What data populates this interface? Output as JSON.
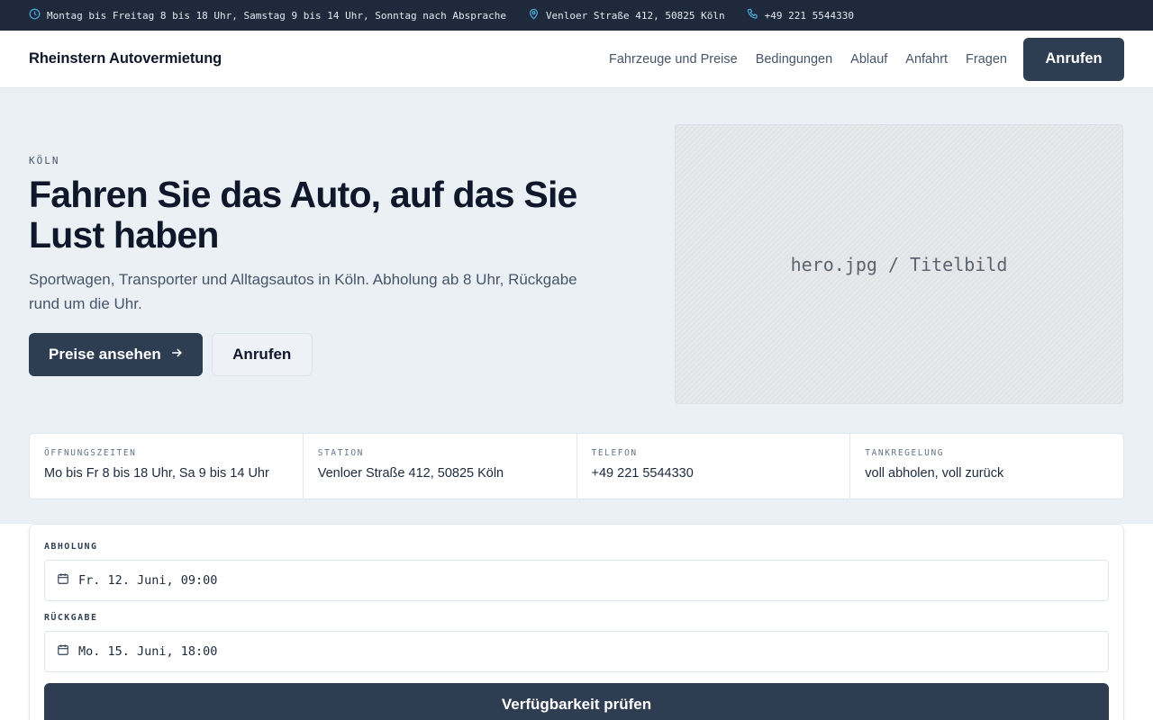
{
  "topbar": {
    "hours": "Montag bis Freitag 8 bis 18 Uhr, Samstag 9 bis 14 Uhr, Sonntag nach Absprache",
    "address": "Venloer Straße 412, 50825 Köln",
    "phone": "+49 221 5544330",
    "icon_color": "#4aa8d8"
  },
  "header": {
    "brand": "Rheinstern Autovermietung",
    "nav": [
      "Fahrzeuge und Preise",
      "Bedingungen",
      "Ablauf",
      "Anfahrt",
      "Fragen"
    ],
    "call_button": "Anrufen"
  },
  "hero": {
    "eyebrow": "KÖLN",
    "title": "Fahren Sie das Auto, auf das Sie Lust haben",
    "subtitle": "Sportwagen, Transporter und Alltagsautos in Köln. Abholung ab 8 Uhr, Rückgabe rund um die Uhr.",
    "primary_button": "Preise ansehen",
    "secondary_button": "Anrufen",
    "image_placeholder": "hero.jpg / Titelbild"
  },
  "info": [
    {
      "label": "ÖFFNUNGSZEITEN",
      "value": "Mo bis Fr 8 bis 18 Uhr, Sa 9 bis 14 Uhr"
    },
    {
      "label": "STATION",
      "value": "Venloer Straße 412, 50825 Köln"
    },
    {
      "label": "TELEFON",
      "value": "+49 221 5544330"
    },
    {
      "label": "TANKREGELUNG",
      "value": "voll abholen, voll zurück"
    }
  ],
  "booking": {
    "pickup_label": "ABHOLUNG",
    "pickup_value": "Fr. 12. Juni, 09:00",
    "return_label": "RÜCKGABE",
    "return_value": "Mo. 15. Juni, 18:00",
    "submit": "Verfügbarkeit prüfen"
  },
  "colors": {
    "dark": "#1e2a3b",
    "button": "#2f3d52",
    "hero_bg": "#ebf0f5"
  }
}
